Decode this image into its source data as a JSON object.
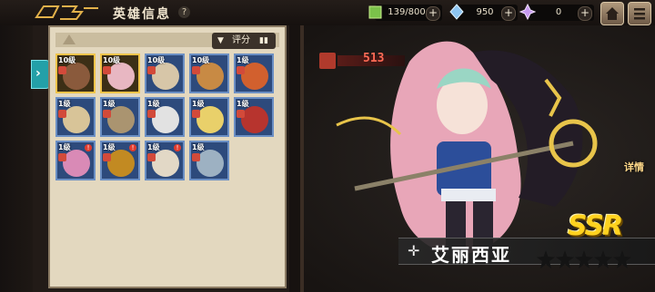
{
  "header": {
    "title": "英雄信息",
    "help_icon": "question-icon",
    "resources": [
      {
        "name": "stamina",
        "value": "139/800",
        "icon": "stamina-cube-icon",
        "color": "#7bc24a"
      },
      {
        "name": "diamond",
        "value": "950",
        "icon": "diamond-icon",
        "color": "#8ec6f2"
      },
      {
        "name": "crystal",
        "value": "0",
        "icon": "crystal-icon",
        "color": "#c79af0"
      }
    ],
    "plus_label": "+",
    "home_icon": "home-icon",
    "menu_icon": "menu-icon"
  },
  "hero_list": {
    "sort_label": "评分",
    "filter_icon": "filter-icon",
    "sort_icon": "bar-chart-icon",
    "cards": [
      {
        "level": "10级",
        "rarity": "gold",
        "alert": false,
        "face": "#8a5a3c"
      },
      {
        "level": "10级",
        "rarity": "gold",
        "alert": false,
        "face": "#e8b7c2"
      },
      {
        "level": "10级",
        "rarity": "blue",
        "alert": false,
        "face": "#d7c6a8"
      },
      {
        "level": "10级",
        "rarity": "blue",
        "alert": false,
        "face": "#c88a44"
      },
      {
        "level": "1级",
        "rarity": "blue",
        "alert": false,
        "face": "#d2602e"
      },
      {
        "level": "1级",
        "rarity": "blue",
        "alert": false,
        "face": "#d8c498"
      },
      {
        "level": "1级",
        "rarity": "blue",
        "alert": false,
        "face": "#aa9470"
      },
      {
        "level": "1级",
        "rarity": "blue",
        "alert": false,
        "face": "#e2e2e2"
      },
      {
        "level": "1级",
        "rarity": "blue",
        "alert": false,
        "face": "#e9d06a"
      },
      {
        "level": "1级",
        "rarity": "blue",
        "alert": false,
        "face": "#b7342e"
      },
      {
        "level": "1级",
        "rarity": "blue",
        "alert": true,
        "face": "#d98ab6"
      },
      {
        "level": "1级",
        "rarity": "blue",
        "alert": true,
        "face": "#c28a22"
      },
      {
        "level": "1级",
        "rarity": "blue",
        "alert": true,
        "face": "#e2d8c6"
      },
      {
        "level": "1级",
        "rarity": "blue",
        "alert": false,
        "face": "#9db1c2"
      }
    ]
  },
  "hero": {
    "power": "513",
    "power_icon": "fist-icon",
    "detail_label": "详情",
    "rarity": "SSR",
    "name": "艾丽西亚",
    "name_icon": "class-cross-icon",
    "stars_total": 5
  },
  "side_tab_icon": "expand-arrow-icon"
}
